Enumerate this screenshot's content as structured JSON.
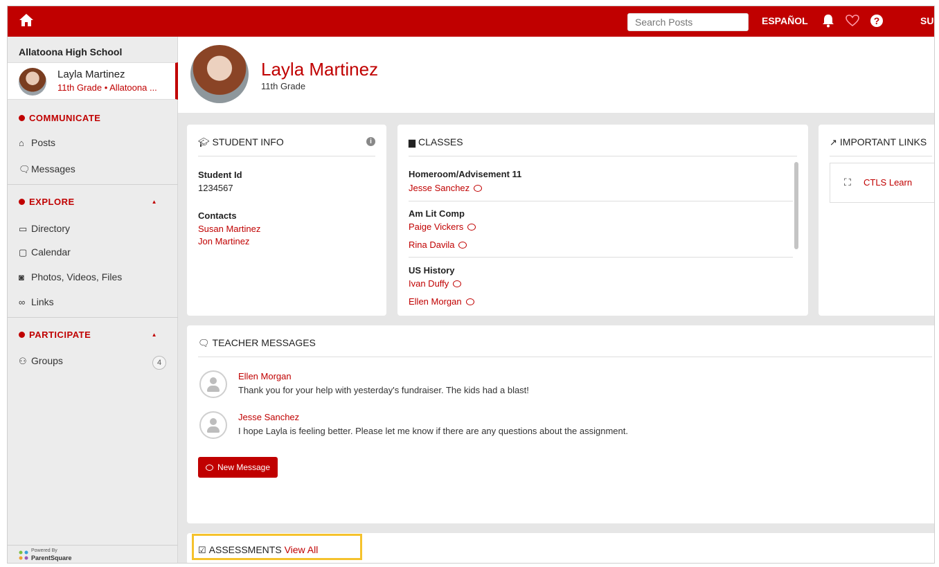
{
  "topbar": {
    "home_icon": "home-icon",
    "search_placeholder": "Search Posts",
    "language": "ESPAÑOL",
    "bell_icon": "bell-icon",
    "heart_icon": "heart-icon",
    "help_icon": "help-icon",
    "user_trunc": "SU"
  },
  "sidebar": {
    "school": "Allatoona High School",
    "student": {
      "name": "Layla Martinez",
      "subtitle": "11th Grade • Allatoona ..."
    },
    "sections": {
      "communicate": "COMMUNICATE",
      "explore": "EXPLORE",
      "participate": "PARTICIPATE"
    },
    "items": {
      "posts": "Posts",
      "messages": "Messages",
      "directory": "Directory",
      "calendar": "Calendar",
      "media": "Photos, Videos, Files",
      "links": "Links",
      "groups": "Groups",
      "groups_count": "4"
    },
    "powered_by": "Powered By",
    "brand": "ParentSquare"
  },
  "profile": {
    "name": "Layla Martinez",
    "grade": "11th Grade"
  },
  "student_info": {
    "title": "STUDENT INFO",
    "id_label": "Student Id",
    "id_value": "1234567",
    "contacts_label": "Contacts",
    "contacts": [
      "Susan Martinez",
      "Jon Martinez"
    ]
  },
  "classes": {
    "title": "CLASSES",
    "items": [
      {
        "name": "Homeroom/Advisement 11",
        "teachers": [
          "Jesse Sanchez"
        ]
      },
      {
        "name": "Am Lit Comp",
        "teachers": [
          "Paige Vickers",
          "Rina Davila"
        ]
      },
      {
        "name": "US History",
        "teachers": [
          "Ivan Duffy",
          "Ellen Morgan"
        ]
      }
    ]
  },
  "important_links": {
    "title": "IMPORTANT LINKS",
    "link": "CTLS Learn"
  },
  "teacher_messages": {
    "title": "TEACHER MESSAGES",
    "messages": [
      {
        "name": "Ellen Morgan",
        "text": "Thank you for your help with yesterday's fundraiser. The kids had a blast!"
      },
      {
        "name": "Jesse Sanchez",
        "text": "I hope Layla is feeling better. Please let me know if there are any questions about the assignment."
      }
    ],
    "button": "New Message"
  },
  "assessments": {
    "title": "ASSESSMENTS",
    "view_all": "View All"
  },
  "colors": {
    "brand_red": "#c00000",
    "highlight": "#f5c22c"
  }
}
